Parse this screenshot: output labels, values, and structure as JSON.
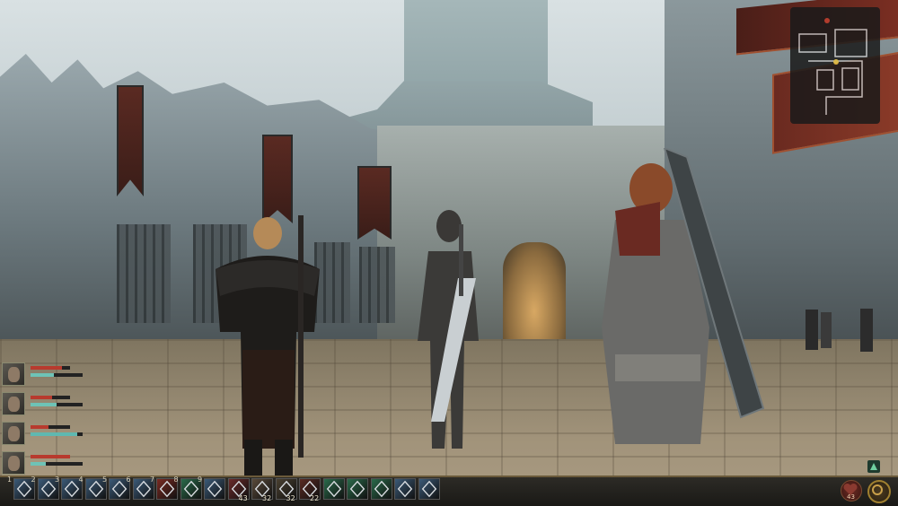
{
  "game": {
    "scene": "courtyard"
  },
  "colors": {
    "health": "#b83a2e",
    "mana": "#5fb8b0",
    "stamina": "#6ec3b6",
    "accent_gold": "#c9a04a",
    "frame_red": "#7a2e22"
  },
  "party": [
    {
      "portrait_icon": "portrait-hawke",
      "health": 0.8,
      "resource": 0.45,
      "resource_color": "#6ec3b6"
    },
    {
      "portrait_icon": "portrait-fenris",
      "health": 0.55,
      "resource": 0.5,
      "resource_color": "#6ec3b6"
    },
    {
      "portrait_icon": "portrait-anders",
      "health": 0.45,
      "resource": 0.9,
      "resource_color": "#5fb8b0"
    },
    {
      "portrait_icon": "portrait-aveline",
      "health": 1.0,
      "resource": 0.3,
      "resource_color": "#6ec3b6"
    }
  ],
  "actionbar": {
    "slots": [
      {
        "num": "1",
        "icon": "rogue-skill-icon",
        "color": "#3b5a78"
      },
      {
        "num": "2",
        "icon": "rogue-skill-icon",
        "color": "#3b5a78"
      },
      {
        "num": "3",
        "icon": "rogue-skill-icon",
        "color": "#3b5a78"
      },
      {
        "num": "4",
        "icon": "rogue-skill-icon",
        "color": "#3b5a78"
      },
      {
        "num": "5",
        "icon": "rogue-skill-icon",
        "color": "#3b5a78"
      },
      {
        "num": "6",
        "icon": "rogue-skill-icon",
        "color": "#3b5a78"
      },
      {
        "num": "7",
        "icon": "fire-skill-icon",
        "color": "#7a2a22"
      },
      {
        "num": "8",
        "icon": "sustain-skill-icon",
        "color": "#2a6a4a"
      },
      {
        "num": "9",
        "icon": "rogue-skill-icon",
        "color": "#3b5a78"
      },
      {
        "num": "",
        "icon": "health-potion-icon",
        "color": "#6a2a2a",
        "count": "43"
      },
      {
        "num": "",
        "icon": "poultice-icon",
        "color": "#5a4a3a",
        "count": "32"
      },
      {
        "num": "",
        "icon": "bomb-icon",
        "color": "#4a4030",
        "count": "32"
      },
      {
        "num": "",
        "icon": "injury-kit-icon",
        "color": "#5a2a22",
        "count": "22"
      },
      {
        "num": "",
        "icon": "sustain-skill-icon",
        "color": "#2a6a4a"
      },
      {
        "num": "",
        "icon": "sustain-skill-icon",
        "color": "#2a6a4a"
      },
      {
        "num": "",
        "icon": "sustain-skill-icon",
        "color": "#2a6a4a"
      },
      {
        "num": "",
        "icon": "rogue-skill-icon",
        "color": "#3b5a78"
      },
      {
        "num": "",
        "icon": "rogue-skill-icon",
        "color": "#3b5a78"
      }
    ],
    "heal_count": "43"
  }
}
